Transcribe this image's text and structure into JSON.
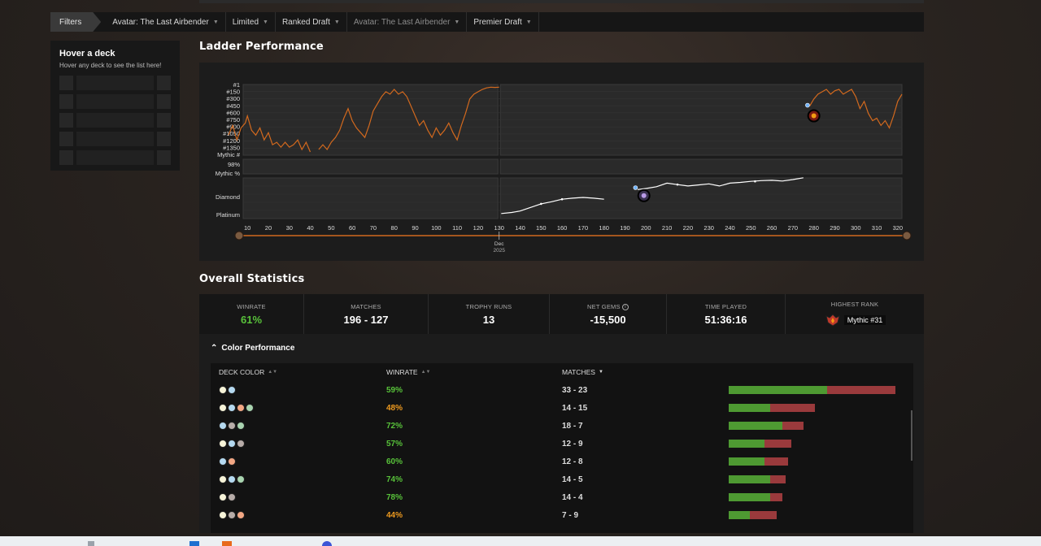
{
  "filters": {
    "label": "Filters",
    "chips": [
      {
        "label": "Avatar: The Last Airbender",
        "dim": false
      },
      {
        "label": "Limited",
        "dim": false
      },
      {
        "label": "Ranked Draft",
        "dim": false
      },
      {
        "label": "Avatar: The Last Airbender",
        "dim": true
      },
      {
        "label": "Premier Draft",
        "dim": false
      }
    ]
  },
  "sidebar": {
    "title": "Hover a deck",
    "subtitle": "Hover any deck to see the list here!"
  },
  "ladder": {
    "title": "Ladder Performance"
  },
  "chart_data": {
    "type": "line",
    "title": "",
    "series": [
      {
        "name": "Mythic #",
        "color": "#d2691e",
        "points": [
          [
            1,
            1000
          ],
          [
            3,
            800
          ],
          [
            5,
            1100
          ],
          [
            7,
            850
          ],
          [
            9,
            750
          ],
          [
            10,
            600
          ],
          [
            12,
            900
          ],
          [
            14,
            1000
          ],
          [
            16,
            850
          ],
          [
            18,
            1100
          ],
          [
            20,
            950
          ],
          [
            22,
            1200
          ],
          [
            24,
            1150
          ],
          [
            26,
            1250
          ],
          [
            28,
            1150
          ],
          [
            30,
            1250
          ],
          [
            32,
            1200
          ],
          [
            34,
            1100
          ],
          [
            36,
            1300
          ],
          [
            38,
            1150
          ],
          [
            40,
            1350
          ],
          [
            null,
            null
          ],
          [
            44,
            1300
          ],
          [
            46,
            1200
          ],
          [
            48,
            1300
          ],
          [
            50,
            1150
          ],
          [
            52,
            1050
          ],
          [
            54,
            900
          ],
          [
            56,
            650
          ],
          [
            58,
            450
          ],
          [
            60,
            700
          ],
          [
            62,
            850
          ],
          [
            64,
            950
          ],
          [
            66,
            1050
          ],
          [
            68,
            800
          ],
          [
            70,
            500
          ],
          [
            72,
            350
          ],
          [
            74,
            200
          ],
          [
            76,
            100
          ],
          [
            78,
            150
          ],
          [
            80,
            50
          ],
          [
            82,
            150
          ],
          [
            84,
            100
          ],
          [
            86,
            200
          ],
          [
            88,
            400
          ],
          [
            90,
            600
          ],
          [
            92,
            800
          ],
          [
            94,
            700
          ],
          [
            96,
            900
          ],
          [
            98,
            1050
          ],
          [
            100,
            850
          ],
          [
            102,
            1000
          ],
          [
            104,
            900
          ],
          [
            106,
            750
          ],
          [
            108,
            950
          ],
          [
            110,
            1100
          ],
          [
            112,
            800
          ],
          [
            114,
            550
          ],
          [
            116,
            250
          ],
          [
            118,
            150
          ],
          [
            120,
            100
          ],
          [
            122,
            50
          ],
          [
            124,
            20
          ],
          [
            126,
            5
          ],
          [
            128,
            10
          ],
          [
            130,
            5
          ],
          [
            null,
            null
          ],
          [
            278,
            400
          ],
          [
            280,
            250
          ],
          [
            282,
            150
          ],
          [
            284,
            100
          ],
          [
            286,
            50
          ],
          [
            288,
            150
          ],
          [
            290,
            80
          ],
          [
            292,
            50
          ],
          [
            294,
            150
          ],
          [
            296,
            100
          ],
          [
            298,
            50
          ],
          [
            300,
            200
          ],
          [
            302,
            450
          ],
          [
            304,
            300
          ],
          [
            306,
            550
          ],
          [
            308,
            700
          ],
          [
            310,
            650
          ],
          [
            312,
            800
          ],
          [
            314,
            700
          ],
          [
            316,
            850
          ],
          [
            318,
            600
          ],
          [
            320,
            300
          ],
          [
            322,
            150
          ]
        ]
      },
      {
        "name": "Diamond / Platinum",
        "color": "#ffffff",
        "points": [
          [
            131,
            0.05
          ],
          [
            136,
            0.08
          ],
          [
            140,
            0.12
          ],
          [
            145,
            0.22
          ],
          [
            150,
            0.32
          ],
          [
            155,
            0.38
          ],
          [
            160,
            0.45
          ],
          [
            165,
            0.48
          ],
          [
            170,
            0.5
          ],
          [
            175,
            0.48
          ],
          [
            180,
            0.45
          ],
          [
            null,
            null
          ],
          [
            196,
            0.72
          ],
          [
            200,
            0.75
          ],
          [
            205,
            0.8
          ],
          [
            210,
            0.9
          ],
          [
            215,
            0.86
          ],
          [
            220,
            0.82
          ],
          [
            225,
            0.85
          ],
          [
            230,
            0.88
          ],
          [
            235,
            0.82
          ],
          [
            240,
            0.9
          ],
          [
            245,
            0.92
          ],
          [
            250,
            0.95
          ],
          [
            255,
            0.97
          ],
          [
            260,
            0.98
          ],
          [
            265,
            0.96
          ],
          [
            270,
            1.0
          ],
          [
            275,
            1.05
          ]
        ]
      }
    ],
    "y_labels_top": [
      "#1",
      "#150",
      "#300",
      "#450",
      "#600",
      "#750",
      "#900",
      "#1050",
      "#1200",
      "#1350",
      "Mythic #"
    ],
    "y_labels_mid": [
      "98%",
      "Mythic %"
    ],
    "y_labels_bottom": [
      "Diamond",
      "Platinum"
    ],
    "x_ticks": [
      10,
      20,
      30,
      40,
      50,
      60,
      70,
      80,
      90,
      100,
      110,
      120,
      130,
      140,
      150,
      160,
      170,
      180,
      190,
      200,
      210,
      220,
      230,
      240,
      250,
      260,
      270,
      280,
      290,
      300,
      310,
      320
    ],
    "x_range": [
      1,
      325
    ],
    "date_marker": {
      "month": "Dec",
      "year": "2025",
      "x": 130
    }
  },
  "overall": {
    "title": "Overall Statistics",
    "stats": [
      {
        "label": "WINRATE",
        "value": "61%",
        "accent": "green"
      },
      {
        "label": "MATCHES",
        "value": "196 - 127"
      },
      {
        "label": "TROPHY RUNS",
        "value": "13"
      },
      {
        "label": "NET GEMS",
        "value": "-15,500"
      },
      {
        "label": "TIME PLAYED",
        "value": "51:36:16"
      },
      {
        "label": "HIGHEST RANK",
        "value": "Mythic #31"
      }
    ]
  },
  "color_perf": {
    "title": "Color Performance",
    "headers": {
      "deck_color": "DECK COLOR",
      "winrate": "WINRATE",
      "matches": "MATCHES"
    },
    "rows": [
      {
        "colors": [
          "W",
          "U"
        ],
        "winrate": "59%",
        "matches": "33 - 23",
        "wins": 33,
        "losses": 23,
        "tone": "green"
      },
      {
        "colors": [
          "W",
          "U",
          "R",
          "G"
        ],
        "winrate": "48%",
        "matches": "14 - 15",
        "wins": 14,
        "losses": 15,
        "tone": "orange"
      },
      {
        "colors": [
          "U",
          "B",
          "G"
        ],
        "winrate": "72%",
        "matches": "18 - 7",
        "wins": 18,
        "losses": 7,
        "tone": "green"
      },
      {
        "colors": [
          "W",
          "U",
          "B"
        ],
        "winrate": "57%",
        "matches": "12 - 9",
        "wins": 12,
        "losses": 9,
        "tone": "green"
      },
      {
        "colors": [
          "U",
          "R"
        ],
        "winrate": "60%",
        "matches": "12 - 8",
        "wins": 12,
        "losses": 8,
        "tone": "green"
      },
      {
        "colors": [
          "W",
          "U",
          "G"
        ],
        "winrate": "74%",
        "matches": "14 - 5",
        "wins": 14,
        "losses": 5,
        "tone": "green"
      },
      {
        "colors": [
          "W",
          "B"
        ],
        "winrate": "78%",
        "matches": "14 - 4",
        "wins": 14,
        "losses": 4,
        "tone": "green"
      },
      {
        "colors": [
          "W",
          "B",
          "R"
        ],
        "winrate": "44%",
        "matches": "7 - 9",
        "wins": 7,
        "losses": 9,
        "tone": "orange"
      }
    ]
  }
}
